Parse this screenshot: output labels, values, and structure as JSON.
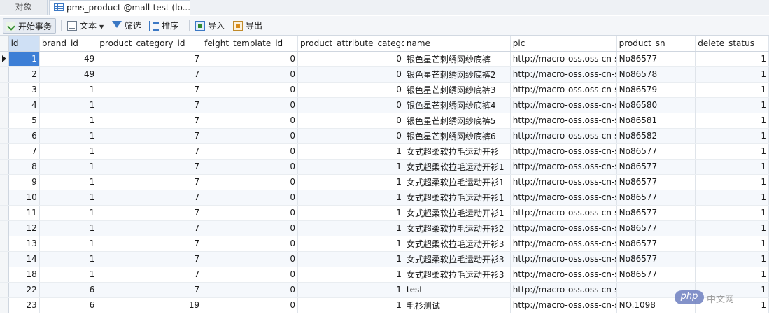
{
  "tabs": {
    "objects_label": "对象",
    "table_label": "pms_product @mall-test (lo..."
  },
  "toolbar": {
    "begin_transaction": "开始事务",
    "text": "文本",
    "filter": "筛选",
    "sort": "排序",
    "import": "导入",
    "export": "导出"
  },
  "grid": {
    "columns": [
      "id",
      "brand_id",
      "product_category_id",
      "feight_template_id",
      "product_attribute_categor",
      "name",
      "pic",
      "product_sn",
      "delete_status"
    ],
    "rows": [
      [
        "1",
        "49",
        "7",
        "0",
        "0",
        "银色星芒刺绣网纱底裤",
        "http://macro-oss.oss-cn-s",
        "No86577",
        "1"
      ],
      [
        "2",
        "49",
        "7",
        "0",
        "0",
        "银色星芒刺绣网纱底裤2",
        "http://macro-oss.oss-cn-s",
        "No86578",
        "1"
      ],
      [
        "3",
        "1",
        "7",
        "0",
        "0",
        "银色星芒刺绣网纱底裤3",
        "http://macro-oss.oss-cn-s",
        "No86579",
        "1"
      ],
      [
        "4",
        "1",
        "7",
        "0",
        "0",
        "银色星芒刺绣网纱底裤4",
        "http://macro-oss.oss-cn-s",
        "No86580",
        "1"
      ],
      [
        "5",
        "1",
        "7",
        "0",
        "0",
        "银色星芒刺绣网纱底裤5",
        "http://macro-oss.oss-cn-s",
        "No86581",
        "1"
      ],
      [
        "6",
        "1",
        "7",
        "0",
        "0",
        "银色星芒刺绣网纱底裤6",
        "http://macro-oss.oss-cn-s",
        "No86582",
        "1"
      ],
      [
        "7",
        "1",
        "7",
        "0",
        "1",
        "女式超柔软拉毛运动开衫",
        "http://macro-oss.oss-cn-s",
        "No86577",
        "1"
      ],
      [
        "8",
        "1",
        "7",
        "0",
        "1",
        "女式超柔软拉毛运动开衫1",
        "http://macro-oss.oss-cn-s",
        "No86577",
        "1"
      ],
      [
        "9",
        "1",
        "7",
        "0",
        "1",
        "女式超柔软拉毛运动开衫1",
        "http://macro-oss.oss-cn-s",
        "No86577",
        "1"
      ],
      [
        "10",
        "1",
        "7",
        "0",
        "1",
        "女式超柔软拉毛运动开衫1",
        "http://macro-oss.oss-cn-s",
        "No86577",
        "1"
      ],
      [
        "11",
        "1",
        "7",
        "0",
        "1",
        "女式超柔软拉毛运动开衫1",
        "http://macro-oss.oss-cn-s",
        "No86577",
        "1"
      ],
      [
        "12",
        "1",
        "7",
        "0",
        "1",
        "女式超柔软拉毛运动开衫2",
        "http://macro-oss.oss-cn-s",
        "No86577",
        "1"
      ],
      [
        "13",
        "1",
        "7",
        "0",
        "1",
        "女式超柔软拉毛运动开衫3",
        "http://macro-oss.oss-cn-s",
        "No86577",
        "1"
      ],
      [
        "14",
        "1",
        "7",
        "0",
        "1",
        "女式超柔软拉毛运动开衫3",
        "http://macro-oss.oss-cn-s",
        "No86577",
        "1"
      ],
      [
        "18",
        "1",
        "7",
        "0",
        "1",
        "女式超柔软拉毛运动开衫3",
        "http://macro-oss.oss-cn-s",
        "No86577",
        "1"
      ],
      [
        "22",
        "6",
        "7",
        "0",
        "1",
        "test",
        "http://macro-oss.oss-cn-s",
        "",
        "1"
      ],
      [
        "23",
        "6",
        "19",
        "0",
        "1",
        "毛衫测试",
        "http://macro-oss.oss-cn-s",
        "NO.1098",
        "1"
      ]
    ],
    "selected_row": 0
  },
  "watermark": {
    "badge": "php",
    "site": "中文网"
  },
  "colors": {
    "selected_cell": "#3d7fd6",
    "header_id_bg": "#cfe0f5",
    "stripe": "#f5f8fc"
  }
}
